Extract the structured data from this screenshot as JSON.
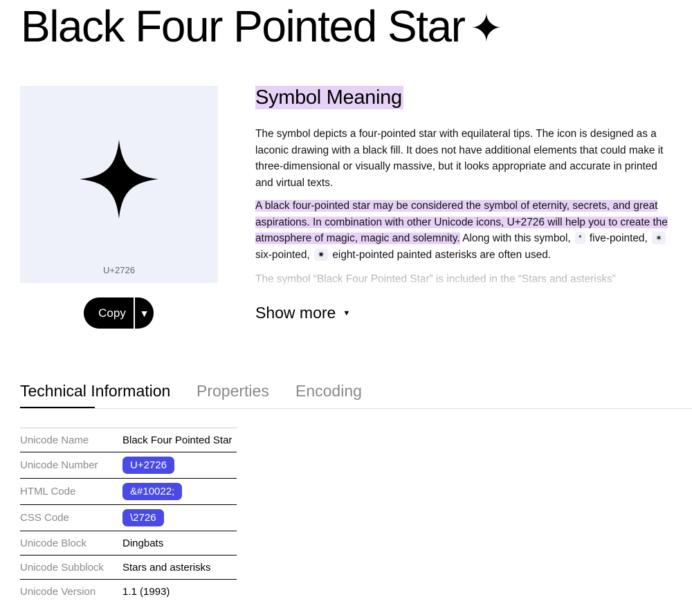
{
  "page": {
    "title": "Black Four Pointed Star",
    "title_glyph": "✦"
  },
  "preview": {
    "code": "U+2726",
    "icon": "black-four-pointed-star"
  },
  "copy_button": {
    "label": "Copy",
    "caret": "▼"
  },
  "meaning": {
    "heading": "Symbol Meaning",
    "paragraph1": "The symbol depicts a four-pointed star with equilateral tips. The icon is designed as a laconic drawing with a black fill. It does not have additional elements that could make it three-dimensional or visually massive, but it looks appropriate and accurate in printed and virtual texts.",
    "paragraph2_highlight": "A black four-pointed star may be considered the symbol of eternity, secrets, and great aspirations. In combination with other Unicode icons, U+2726 will help you to create the atmosphere of magic, magic and solemnity.",
    "paragraph2_rest": " Along with this symbol,",
    "glyph1": "*",
    "text_five": " five-pointed,",
    "glyph2": "✶",
    "text_six": " six-pointed,",
    "glyph3": "✷",
    "text_eight": " eight-pointed painted asterisks are often used.",
    "paragraph3_faded": "The symbol “Black Four Pointed Star” is included in the “Stars and asterisks”",
    "show_more": "Show more",
    "show_more_caret": "▼"
  },
  "tabs": [
    {
      "label": "Technical Information",
      "active": true
    },
    {
      "label": "Properties",
      "active": false
    },
    {
      "label": "Encoding",
      "active": false
    }
  ],
  "tech_info": [
    {
      "label": "Unicode Name",
      "value": "Black Four Pointed Star",
      "pill": false
    },
    {
      "label": "Unicode Number",
      "value": "U+2726",
      "pill": true
    },
    {
      "label": "HTML Code",
      "value": "&#10022;",
      "pill": true
    },
    {
      "label": "CSS Code",
      "value": "\\2726",
      "pill": true
    },
    {
      "label": "Unicode Block",
      "value": "Dingbats",
      "pill": false
    },
    {
      "label": "Unicode Subblock",
      "value": "Stars and asterisks",
      "pill": false
    },
    {
      "label": "Unicode Version",
      "value": "1.1 (1993)",
      "pill": false
    }
  ],
  "colors": {
    "highlight": "#e6d2f7",
    "pill": "#4a4ae6",
    "preview_bg": "#eef1f9"
  }
}
